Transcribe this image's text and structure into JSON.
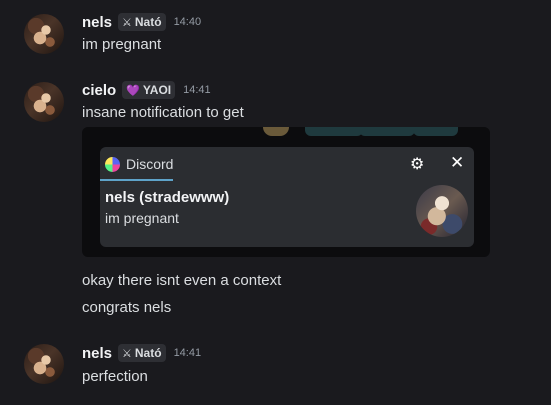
{
  "messages": [
    {
      "username": "nels",
      "tag_icon": "⚔",
      "tag": "Nató",
      "time": "14:40",
      "lines": [
        "im pregnant"
      ]
    },
    {
      "username": "cielo",
      "tag_icon": "💜",
      "tag": "YAOI",
      "time": "14:41",
      "lines": [
        "insane notification to get",
        "okay there isnt even a context",
        "congrats nels"
      ]
    },
    {
      "username": "nels",
      "tag_icon": "⚔",
      "tag": "Nató",
      "time": "14:41",
      "lines": [
        "perfection"
      ]
    }
  ],
  "embed_notification": {
    "app_name": "Discord",
    "sender": "nels (stradewww)",
    "body": "im pregnant",
    "gear_icon": "⚙",
    "close_icon": "✕"
  },
  "colors": {
    "background": "#1a1a1e",
    "notification_bg": "#2b2d31",
    "accent_underline": "#5ea3c9"
  }
}
